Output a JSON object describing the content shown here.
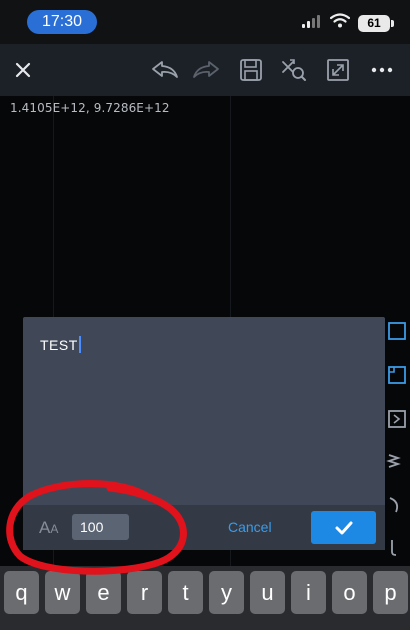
{
  "status_bar": {
    "time": "17:30",
    "battery": "61",
    "icons": [
      "signal-icon",
      "wifi-icon",
      "battery-icon"
    ]
  },
  "toolbar": {
    "icons": [
      "close-icon",
      "undo-icon",
      "redo-icon",
      "save-icon",
      "transform-search-icon",
      "fullscreen-icon",
      "more-icon"
    ]
  },
  "canvas": {
    "coordinates": "1.4105E+12,  9.7286E+12"
  },
  "text_dialog": {
    "typed_text": "TEST",
    "font_size_icon": "Aa",
    "font_size_value": "100",
    "cancel_label": "Cancel",
    "confirm_icon": "check-icon"
  },
  "keyboard": {
    "row1": [
      "q",
      "w",
      "e",
      "r",
      "t",
      "y",
      "u",
      "i",
      "o",
      "p"
    ]
  },
  "colors": {
    "accent": "#1e88e5",
    "link": "#3c9be6",
    "dialog_bg": "#404858",
    "annotation": "#e0121c"
  }
}
